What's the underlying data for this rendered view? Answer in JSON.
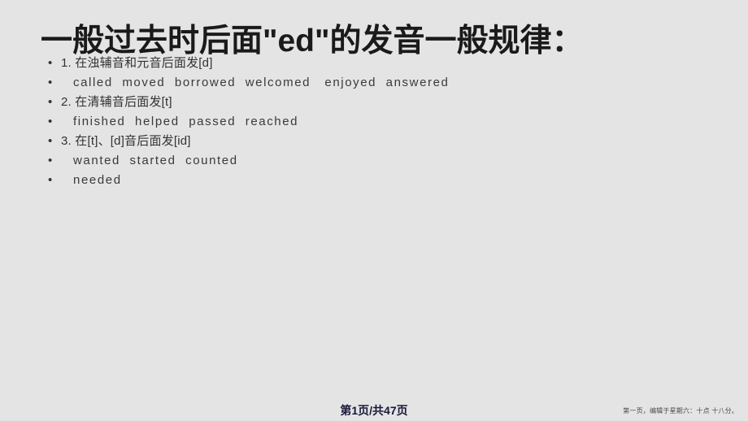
{
  "slide": {
    "background_color": "#e4e4e4",
    "title": "一般过去时后面\"ed\"的发音一般规律：",
    "title_color": "#1a1a1a",
    "bullet_glyph": "•",
    "lines": [
      {
        "level": "num",
        "text": "1. 在浊辅音和元音后面发[d]"
      },
      {
        "level": "words",
        "text": "called  moved  borrowed  welcomed   enjoyed  answered"
      },
      {
        "level": "num",
        "text": "2. 在清辅音后面发[t]"
      },
      {
        "level": "words",
        "text": "finished  helped  passed  reached"
      },
      {
        "level": "num",
        "text": "3. 在[t]、[d]音后面发[id]"
      },
      {
        "level": "words",
        "text": "wanted  started  counted"
      },
      {
        "level": "words",
        "text": "needed"
      }
    ]
  },
  "footer": {
    "page_indicator": "第1页/共47页",
    "page_indicator_color": "#18183a",
    "edit_note": "第一页，编辑于星期六：十点 十八分。",
    "edit_note_color": "#4a4a4a"
  }
}
